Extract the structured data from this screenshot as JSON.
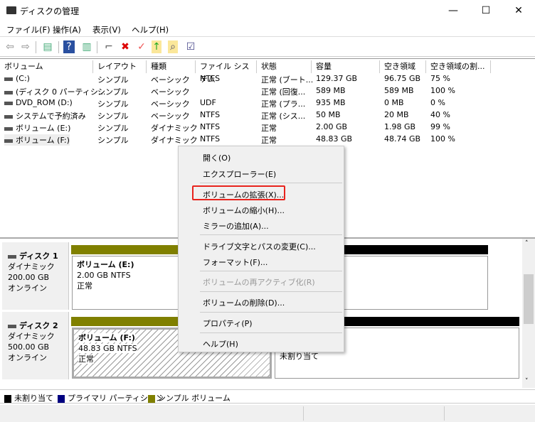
{
  "window": {
    "title": "ディスクの管理",
    "minimize": "—",
    "maximize": "☐",
    "close": "✕"
  },
  "menubar": [
    "ファイル(F)",
    "操作(A)",
    "表示(V)",
    "ヘルプ(H)"
  ],
  "toolbar": [
    "back-icon",
    "forward-icon",
    "console-tree-icon",
    "help-icon",
    "action-pane-icon",
    "connect-drive-icon",
    "delete-icon",
    "check-icon",
    "up-folder-icon",
    "search-folder-icon",
    "properties-icon"
  ],
  "list": {
    "columns": [
      "ボリューム",
      "レイアウト",
      "種類",
      "ファイル システム",
      "状態",
      "容量",
      "空き領域",
      "空き領域の割..."
    ],
    "rows": [
      [
        "(C:)",
        "シンプル",
        "ベーシック",
        "NTFS",
        "正常 (ブート...",
        "129.37 GB",
        "96.75 GB",
        "75 %"
      ],
      [
        "(ディスク 0 パーティシ...",
        "シンプル",
        "ベーシック",
        "",
        "正常 (回復...",
        "589 MB",
        "589 MB",
        "100 %"
      ],
      [
        "DVD_ROM (D:)",
        "シンプル",
        "ベーシック",
        "UDF",
        "正常 (プラ...",
        "935 MB",
        "0 MB",
        "0 %"
      ],
      [
        "システムで予約済み",
        "シンプル",
        "ベーシック",
        "NTFS",
        "正常 (シス...",
        "50 MB",
        "20 MB",
        "40 %"
      ],
      [
        "ボリューム (E:)",
        "シンプル",
        "ダイナミック",
        "NTFS",
        "正常",
        "2.00 GB",
        "1.98 GB",
        "99 %"
      ],
      [
        "ボリューム (F:)",
        "シンプル",
        "ダイナミック",
        "NTFS",
        "正常",
        "48.83 GB",
        "48.74 GB",
        "100 %"
      ]
    ]
  },
  "disks": [
    {
      "name": "ディスク 1",
      "type": "ダイナミック",
      "size": "200.00 GB",
      "status": "オンライン",
      "partition": {
        "name": "ボリューム  (E:)",
        "info": "2.00 GB NTFS",
        "status": "正常"
      }
    },
    {
      "name": "ディスク 2",
      "type": "ダイナミック",
      "size": "500.00 GB",
      "status": "オンライン",
      "partition": {
        "name": "ボリューム  (F:)",
        "info": "48.83 GB NTFS",
        "status": "正常"
      },
      "unallocated": "未割り当て"
    }
  ],
  "legend": [
    {
      "label": "未割り当て",
      "color": "#000000"
    },
    {
      "label": "プライマリ パーティション",
      "color": "#000080"
    },
    {
      "label": "シンプル ボリューム",
      "color": "#808000"
    }
  ],
  "context_menu": {
    "items": [
      "開く(O)",
      "エクスプローラー(E)",
      "ボリュームの拡張(X)...",
      "ボリュームの縮小(H)...",
      "ミラーの追加(A)...",
      "ドライブ文字とパスの変更(C)...",
      "フォーマット(F)...",
      "ボリュームの再アクティブ化(R)",
      "ボリュームの削除(D)...",
      "プロパティ(P)",
      "ヘルプ(H)"
    ],
    "highlighted": "ボリュームの拡張(X)..."
  }
}
